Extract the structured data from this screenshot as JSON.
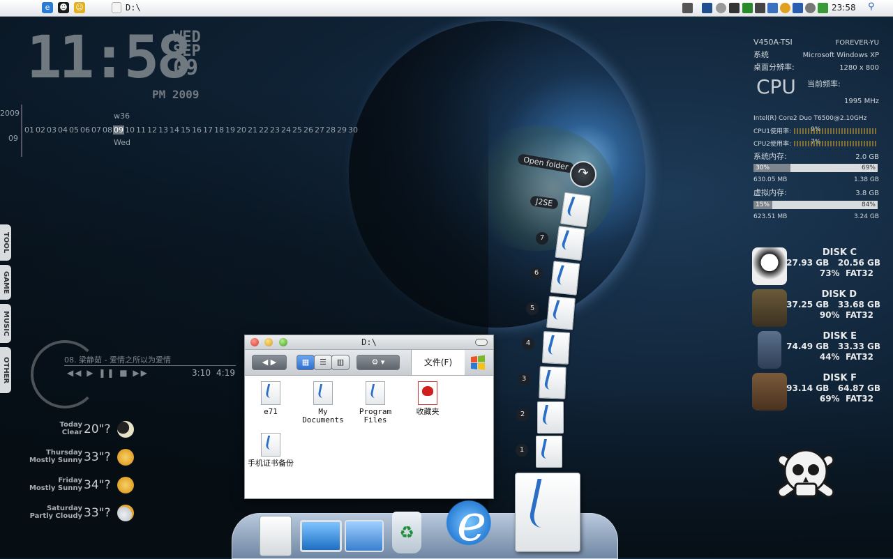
{
  "menubar": {
    "path": "D:\\",
    "clock": "23:58"
  },
  "desktop_clock": {
    "time": "11:58",
    "weekday": "WED",
    "month": "SEP",
    "day": "09",
    "ampm_year": "PM 2009"
  },
  "calendar": {
    "year": "2009",
    "month": "09",
    "week": "w36",
    "weekday": "Wed",
    "days": [
      "01",
      "02",
      "03",
      "04",
      "05",
      "06",
      "07",
      "08",
      "09",
      "10",
      "11",
      "12",
      "13",
      "14",
      "15",
      "16",
      "17",
      "18",
      "19",
      "20",
      "21",
      "22",
      "23",
      "24",
      "25",
      "26",
      "27",
      "28",
      "29",
      "30"
    ],
    "today": "09"
  },
  "side_tabs": [
    "TOOL",
    "GAME",
    "MUSIC",
    "OTHER"
  ],
  "music": {
    "track": "08. 梁静茹 - 爱情之所以为爱情",
    "controls": "◀◀ ▶ ❚❚ ■ ▶▶",
    "elapsed": "3:10",
    "total": "4:19"
  },
  "weather": [
    {
      "day": "Today",
      "cond": "Clear",
      "temp": "20\"?",
      "icon": "moon-icon"
    },
    {
      "day": "Thursday",
      "cond": "Mostly Sunny",
      "temp": "33\"?",
      "icon": "sun-icon"
    },
    {
      "day": "Friday",
      "cond": "Mostly Sunny",
      "temp": "34\"?",
      "icon": "sun-icon"
    },
    {
      "day": "Saturday",
      "cond": "Partly Cloudy",
      "temp": "33\"?",
      "icon": "partly-cloudy-icon"
    }
  ],
  "system": {
    "model": "V450A-TSI",
    "user": "FOREVER-YU",
    "os_label": "系统",
    "os": "Microsoft Windows XP",
    "res_label": "桌面分辨率:",
    "resolution": "1280 x 800",
    "cpu_logo": "CPU",
    "freq_label": "当前频率:",
    "freq": "1995 MHz",
    "cpu_name": "Intel(R) Core2 Duo T6500@2.10GHz",
    "cpu1_label": "CPU1使用率:",
    "cpu1": "9%",
    "cpu2_label": "CPU2使用率:",
    "cpu2": "7%",
    "mem_label": "系统内存:",
    "mem_total": "2.0 GB",
    "mem_used_pct": "30%",
    "mem_free_pct": "69%",
    "mem_used": "630.05 MB",
    "mem_free": "1.38 GB",
    "vmem_label": "虚拟内存:",
    "vmem_total": "3.8 GB",
    "vmem_used_pct": "15%",
    "vmem_free_pct": "84%",
    "vmem_used": "623.51 MB",
    "vmem_free": "3.24 GB",
    "mem_fill": 0.3,
    "vmem_fill": 0.15
  },
  "disks": [
    {
      "name": "DISK C",
      "total": "27.93 GB",
      "free": "20.56 GB",
      "pct": "73%",
      "fs": "FAT32",
      "icon": "cap-icon"
    },
    {
      "name": "DISK D",
      "total": "37.25 GB",
      "free": "33.68 GB",
      "pct": "90%",
      "fs": "FAT32",
      "icon": "jacket-icon"
    },
    {
      "name": "DISK E",
      "total": "74.49 GB",
      "free": "33.33 GB",
      "pct": "44%",
      "fs": "FAT32",
      "icon": "jeans-icon"
    },
    {
      "name": "DISK F",
      "total": "93.14 GB",
      "free": "64.87 GB",
      "pct": "69%",
      "fs": "FAT32",
      "icon": "boots-icon"
    }
  ],
  "stack": {
    "open_label": "Open folder",
    "top_label": "J2SE",
    "numbers": [
      "7",
      "6",
      "5",
      "4",
      "3",
      "2",
      "1"
    ]
  },
  "window": {
    "title": "D:\\",
    "file_menu": "文件(F)",
    "files": [
      {
        "name": "e71",
        "icon": "folder-icon"
      },
      {
        "name": "My Documents",
        "icon": "folder-icon"
      },
      {
        "name": "Program Files",
        "icon": "folder-icon"
      },
      {
        "name": "收藏夹",
        "icon": "favorites-icon"
      },
      {
        "name": "手机证书备份",
        "icon": "folder-icon"
      }
    ]
  },
  "dock": [
    "documents-icon",
    "computer-icon",
    "network-icon",
    "recycle-bin-icon",
    "internet-explorer-icon",
    "folder-stack-icon"
  ]
}
